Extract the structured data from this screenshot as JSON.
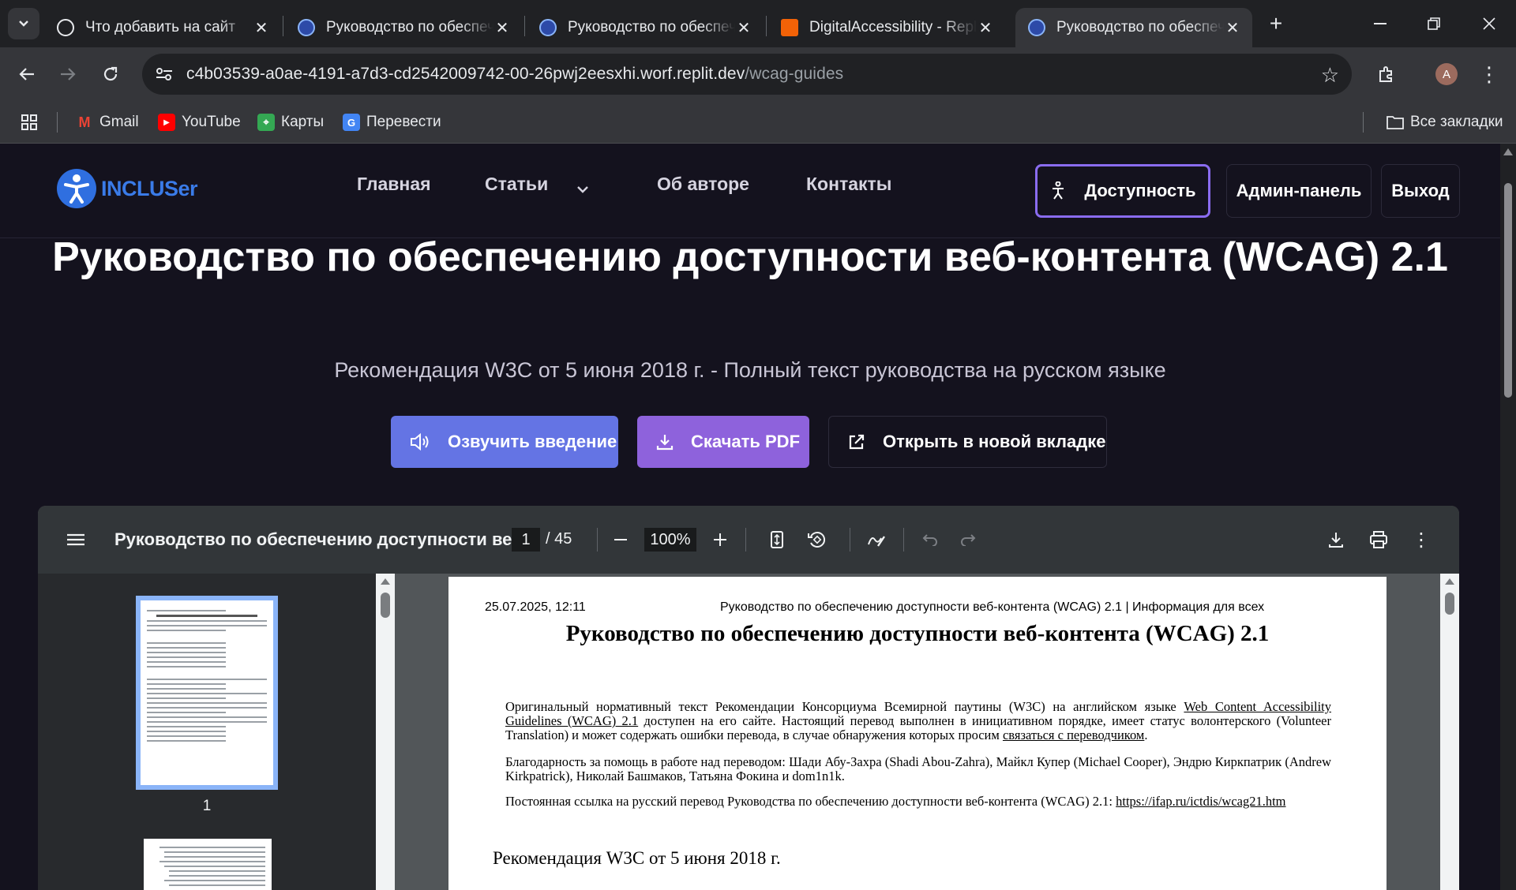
{
  "browser": {
    "tabs": [
      {
        "title": "Что добавить на сайт"
      },
      {
        "title": "Руководство по обеспечению доступности"
      },
      {
        "title": "Руководство по обеспечению доступности"
      },
      {
        "title": "DigitalAccessibility - Replit"
      },
      {
        "title": "Руководство по обеспечению доступности"
      }
    ],
    "url_host": "c4b03539-a0ae-4191-a7d3-cd2542009742-00-26pwj2eesxhi.worf.replit.dev",
    "url_path": "/wcag-guides",
    "avatar_letter": "A",
    "bookmarks": [
      "Gmail",
      "YouTube",
      "Карты",
      "Перевести"
    ],
    "all_bookmarks": "Все закладки"
  },
  "site": {
    "logo": "INCLUSer",
    "nav": [
      "Главная",
      "Статьи",
      "Об авторе",
      "Контакты"
    ],
    "buttons": {
      "accessibility": "Доступность",
      "admin": "Админ-панель",
      "logout": "Выход"
    },
    "title": "Руководство по обеспечению доступности веб-контента (WCAG) 2.1",
    "subtitle": "Рекомендация W3C от 5 июня 2018 г. - Полный текст руководства на русском языке",
    "actions": {
      "speak": "Озвучить введение",
      "download": "Скачать PDF",
      "open": "Открыть в новой вкладке"
    },
    "colors": {
      "accent": "#8a6cf0",
      "blue": "#6474e4",
      "purple": "#8e62dc",
      "background": "#14121e"
    }
  },
  "pdf": {
    "title": "Руководство по обеспечению доступности ве...",
    "page": "1",
    "total": "/ 45",
    "zoom": "100%",
    "thumb_label": "1",
    "page_header_date": "25.07.2025, 12:11",
    "page_header_title": "Руководство по обеспечению доступности веб-контента (WCAG) 2.1 | Информация для всех",
    "doc_title": "Руководство по обеспечению доступности веб-контента (WCAG) 2.1",
    "p1_before": "Оригинальный нормативный текст Рекомендации Консорциума Всемирной паутины (W3C) на английском языке ",
    "p1_link": "Web Content Accessibility Guidelines (WCAG) 2.1",
    "p1_after": " доступен на его сайте. Настоящий перевод выполнен в инициативном порядке, имеет статус волонтерского (Volunteer Translation) и может содержать ошибки перевода, в случае обнаружения которых просим ",
    "p1_link2": "связаться с переводчиком",
    "p1_end": ".",
    "p2": "Благодарность за помощь в работе над переводом: Шади Абу-Захра (Shadi Abou-Zahra), Майкл Купер (Michael Cooper), Эндрю Киркпатрик (Andrew Kirkpatrick), Николай Башмаков, Татьяна Фокина и dom1n1k.",
    "p3_before": "Постоянная ссылка на русский перевод Руководства по обеспечению доступности веб-контента (WCAG) 2.1: ",
    "p3_link": "https://ifap.ru/ictdis/wcag21.htm",
    "h2": "Рекомендация W3C от 5 июня 2018 г."
  }
}
